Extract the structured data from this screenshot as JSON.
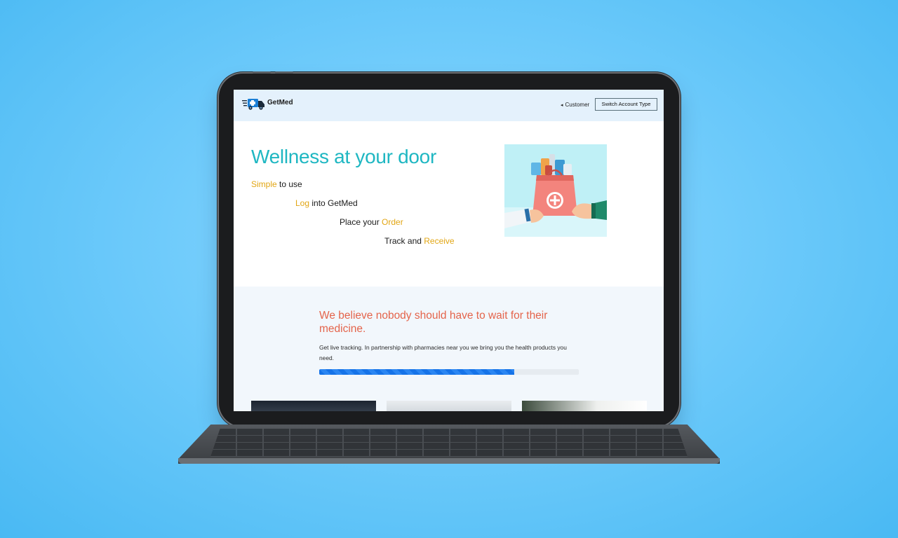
{
  "header": {
    "brand": "GetMed",
    "role_label": "Customer",
    "switch_button": "Switch Account Type"
  },
  "hero": {
    "title": "Wellness at your door",
    "steps": [
      {
        "highlight": "Simple",
        "text": " to use"
      },
      {
        "highlight": "Log",
        "text": " into GetMed"
      },
      {
        "prefix": "Place your ",
        "highlight": "Order"
      },
      {
        "prefix": "Track and ",
        "highlight": "Receive"
      }
    ]
  },
  "mission": {
    "title": "We believe nobody should have to wait for their medicine.",
    "text": "Get live tracking. In partnership with pharmacies near you we bring you the health products you need.",
    "progress": 0.75
  },
  "colors": {
    "accent_teal": "#1fb7c2",
    "highlight_yellow": "#e2a614",
    "mission_red": "#e4644b",
    "progress_blue": "#1673e8",
    "header_bg": "#e4f1fc"
  }
}
